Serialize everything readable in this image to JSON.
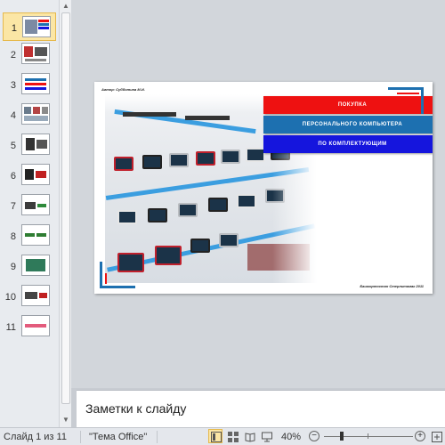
{
  "thumbnails": [
    {
      "number": "1"
    },
    {
      "number": "2"
    },
    {
      "number": "3"
    },
    {
      "number": "4"
    },
    {
      "number": "5"
    },
    {
      "number": "6"
    },
    {
      "number": "7"
    },
    {
      "number": "8"
    },
    {
      "number": "9"
    },
    {
      "number": "10"
    },
    {
      "number": "11"
    }
  ],
  "slide": {
    "author": "Автор: Субботина М.И.",
    "band1": "ПОКУПКА",
    "band2": "ПЕРСОНАЛЬНОГО  КОМПЬЮТЕРА",
    "band3": "ПО КОМПЛЕКТУЮЩИМ",
    "credit": "Башкортостан Стерлитамак 2011"
  },
  "notes": {
    "placeholder": "Заметки к слайду"
  },
  "status": {
    "slide_counter": "Слайд 1 из 11",
    "theme": "\"Тема Office\"",
    "zoom": "40%",
    "zoom_minus": "−",
    "zoom_plus": "+"
  },
  "colors": {
    "band_red": "#ee1111",
    "band_blue": "#1d70b0",
    "band_dark_blue": "#1515dd",
    "selection": "#fbe6a5"
  }
}
